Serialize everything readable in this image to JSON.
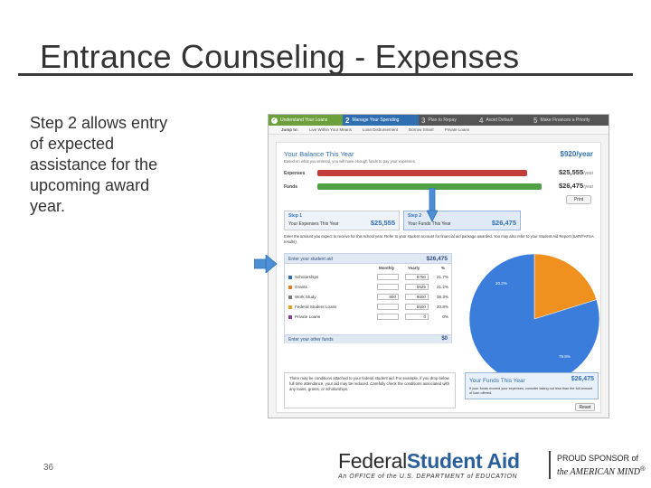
{
  "slide": {
    "title": "Entrance Counseling - Expenses",
    "body": "Step 2 allows entry of expected assistance for the upcoming award year.",
    "page_number": "36"
  },
  "footer": {
    "brand_part1": "Federal",
    "brand_part2": "Student Aid",
    "tagline": "An OFFICE of the U.S. DEPARTMENT of EDUCATION",
    "proud_line1": "PROUD SPONSOR of",
    "proud_line2": "the AMERICAN MIND",
    "trademark": "®"
  },
  "app": {
    "steps": [
      {
        "num": "",
        "label": "Understand Your Loans",
        "state": "done"
      },
      {
        "num": "2",
        "label": "Manage Your Spending",
        "state": "active"
      },
      {
        "num": "3",
        "label": "Plan to Repay",
        "state": "todo"
      },
      {
        "num": "4",
        "label": "Avoid Default",
        "state": "todo"
      },
      {
        "num": "5",
        "label": "Make Finances a Priority",
        "state": "todo"
      }
    ],
    "check_glyph": "✓",
    "jump_to": "Jump to:",
    "subnav": [
      "Live Within Your Means",
      "Loan Disbursement",
      "Borrow Smart",
      "Private Loans"
    ],
    "balance": {
      "title": "Your Balance This Year",
      "subtitle": "Based on what you entered, you will have enough funds to pay your expenses.",
      "amount": "$920/year",
      "expenses_label": "Expenses",
      "expenses_amount": "$25,555",
      "funds_label": "Funds",
      "funds_amount": "$26,475",
      "per": "/year",
      "print_label": "Print"
    },
    "step1": {
      "key": "Step 1",
      "label": "Your Expenses This Year",
      "value": "$25,555"
    },
    "step2": {
      "key": "Step 2",
      "label": "Your Funds This Year",
      "value": "$26,475"
    },
    "instructions": "Enter the amount you expect to receive for this school year. Refer to your student account for financial aid package awarded. You may also refer to your Student Aid Report (SAR/FAFSA results).",
    "aid": {
      "header": "Enter your student aid",
      "total": "$26,475",
      "col_monthly": "Monthly",
      "col_yearly": "Yearly",
      "col_pct": "%",
      "rows": [
        {
          "name": "Scholarships",
          "monthly": "",
          "yearly": "5750",
          "pct": "21.7%",
          "color": "#2f6fb1"
        },
        {
          "name": "Grants",
          "monthly": "",
          "yearly": "5625",
          "pct": "21.2%",
          "color": "#e07b22"
        },
        {
          "name": "Work Study",
          "monthly": "800",
          "yearly": "9600",
          "pct": "36.3%",
          "color": "#7a7a7a"
        },
        {
          "name": "Federal Student Loans",
          "monthly": "",
          "yearly": "5500",
          "pct": "20.8%",
          "color": "#d8a21d"
        },
        {
          "name": "Private Loans",
          "monthly": "",
          "yearly": "0",
          "pct": "0%",
          "color": "#8b3a9b"
        }
      ],
      "other_label": "Enter your other funds",
      "other_value": "$0"
    },
    "pie": {
      "slices": [
        {
          "label": "Funds A",
          "pct": 20.2,
          "color": "#f0901e"
        },
        {
          "label": "Funds B",
          "pct": 79.8,
          "color": "#3a7ddb"
        }
      ],
      "label_a": "20.2%",
      "label_b": "79.8%"
    },
    "conditions": "There may be conditions attached to your federal student aid. For example, if you drop below full time attendance, your aid may be reduced. Carefully check the conditions associated with any loans, grants, or scholarships.",
    "funds_box": {
      "title": "Your Funds This Year",
      "value": "$26,475",
      "desc": "If your funds exceed your expenses, consider taking out less than the full amount of loan offered."
    },
    "reset_label": "Reset"
  }
}
